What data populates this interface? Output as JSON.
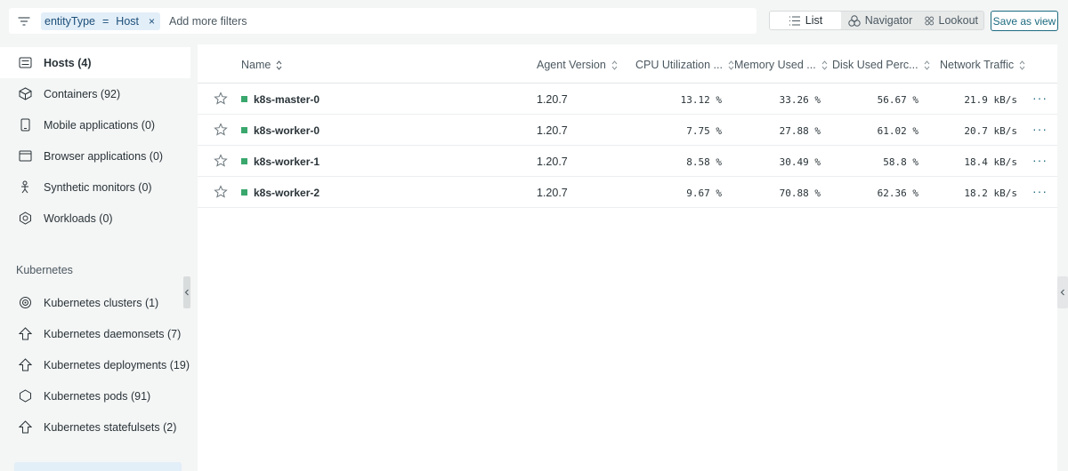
{
  "filter": {
    "key": "entityType",
    "operator": "=",
    "value": "Host",
    "remove": "×",
    "add_label": "Add more filters"
  },
  "view_toggle": {
    "list": "List",
    "navigator": "Navigator",
    "lookout": "Lookout",
    "active": "List"
  },
  "save_label": "Save as view",
  "sidebar": {
    "items": [
      {
        "label": "Hosts (4)",
        "icon": "hosts-icon",
        "active": true
      },
      {
        "label": "Containers (92)",
        "icon": "container-icon"
      },
      {
        "label": "Mobile applications (0)",
        "icon": "mobile-icon"
      },
      {
        "label": "Browser applications (0)",
        "icon": "browser-icon"
      },
      {
        "label": "Synthetic monitors (0)",
        "icon": "synthetic-icon"
      },
      {
        "label": "Workloads (0)",
        "icon": "workloads-icon"
      }
    ],
    "section_title": "Kubernetes",
    "k8s_items": [
      {
        "label": "Kubernetes clusters (1)",
        "icon": "cluster-icon"
      },
      {
        "label": "Kubernetes daemonsets (7)",
        "icon": "daemonset-icon"
      },
      {
        "label": "Kubernetes deployments (19)",
        "icon": "deployment-icon"
      },
      {
        "label": "Kubernetes pods (91)",
        "icon": "pod-icon"
      },
      {
        "label": "Kubernetes statefulsets (2)",
        "icon": "statefulset-icon"
      }
    ]
  },
  "table": {
    "columns": [
      "Name",
      "Agent Version",
      "CPU Utilization ...",
      "Memory Used ...",
      "Disk Used Perc...",
      "Network Traffic"
    ],
    "rows": [
      {
        "name": "k8s-master-0",
        "agent": "1.20.7",
        "cpu": "13.12 %",
        "mem": "33.26 %",
        "disk": "56.67 %",
        "net": "21.9 kB/s"
      },
      {
        "name": "k8s-worker-0",
        "agent": "1.20.7",
        "cpu": "7.75 %",
        "mem": "27.88 %",
        "disk": "61.02 %",
        "net": "20.7 kB/s"
      },
      {
        "name": "k8s-worker-1",
        "agent": "1.20.7",
        "cpu": "8.58 %",
        "mem": "30.49 %",
        "disk": "58.8 %",
        "net": "18.4 kB/s"
      },
      {
        "name": "k8s-worker-2",
        "agent": "1.20.7",
        "cpu": "9.67 %",
        "mem": "70.88 %",
        "disk": "62.36 %",
        "net": "18.2 kB/s"
      }
    ],
    "more_glyph": "···"
  },
  "colors": {
    "accent": "#1d6b80",
    "status_ok": "#3aa76d",
    "chip_bg": "#e2eef8"
  }
}
